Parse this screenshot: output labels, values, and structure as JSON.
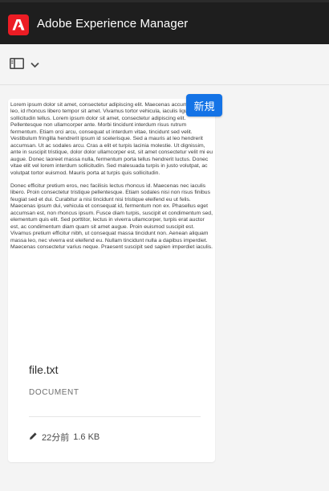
{
  "header": {
    "app_title": "Adobe Experience Manager",
    "logo_icon": "adobe-logo-icon"
  },
  "toolbar": {
    "rail_toggle_icon": "rail-toggle-icon",
    "dropdown_icon": "chevron-down-icon"
  },
  "card": {
    "badge": "新規",
    "preview_paragraphs": [
      "Lorem ipsum dolor sit amet, consectetur adipiscing elit. Maecenas accumsan diam leo, id rhoncus libero tempor sit amet. Vivamus tortor vehicula, iaculis ligula at, sollicitudin tellus. Lorem ipsum dolor sit amet, consectetur adipiscing elit. Pellentesque non ullamcorper ante. Morbi tincidunt interdum risus rutrum fermentum. Etiam orci arcu, consequat ut interdum vitae, tincidunt sed velit. Vestibulum fringilla hendrerit ipsum id scelerisque. Sed a mauris at leo hendrerit accumsan. Ut ac sodales arcu. Cras a elit et turpis lacinia molestie. Ut dignissim, ante in suscipit tristique, dolor dolor ullamcorper est, sit amet consectetur velit mi eu augue. Donec laoreet massa nulla, fermentum porta tellus hendrerit luctus. Donec vitae elit vel lorem interdum sollicitudin. Sed malesuada turpis in justo volutpat, ac volutpat tortor euismod. Mauris porta at turpis quis sollicitudin.",
      "Donec efficitur pretium eros, nec facilisis lectus rhoncus id. Maecenas nec iaculis libero. Proin consectetur tristique pellentesque. Etiam sodales nisi non risus finibus feugiat sed et dui. Curabitur a nisi tincidunt nisi tristique eleifend eu ut felis. Maecenas ipsum dui, vehicula et consequat id, fermentum non ex. Phasellus eget accumsan est, non rhoncus ipsum. Fusce diam turpis, suscipit et condimentum sed, elementum quis elit. Sed porttitor, lectus in viverra ullamcorper, turpis erat auctor est, ac condimentum diam quam sit amet augue. Proin euismod suscipit est. Vivamus pretium efficitur nibh, ut consequat massa tincidunt non. Aenean aliquam massa leo, nec viverra est eleifend eu. Nullam tincidunt nulla a dapibus imperdiet. Maecenas consectetur varius neque. Praesent suscipit sed sapien imperdiet iaculis."
    ],
    "filename": "file.txt",
    "filetype": "DOCUMENT",
    "modified": "22分前",
    "size": "1.6 KB",
    "edit_icon": "pencil-icon"
  }
}
